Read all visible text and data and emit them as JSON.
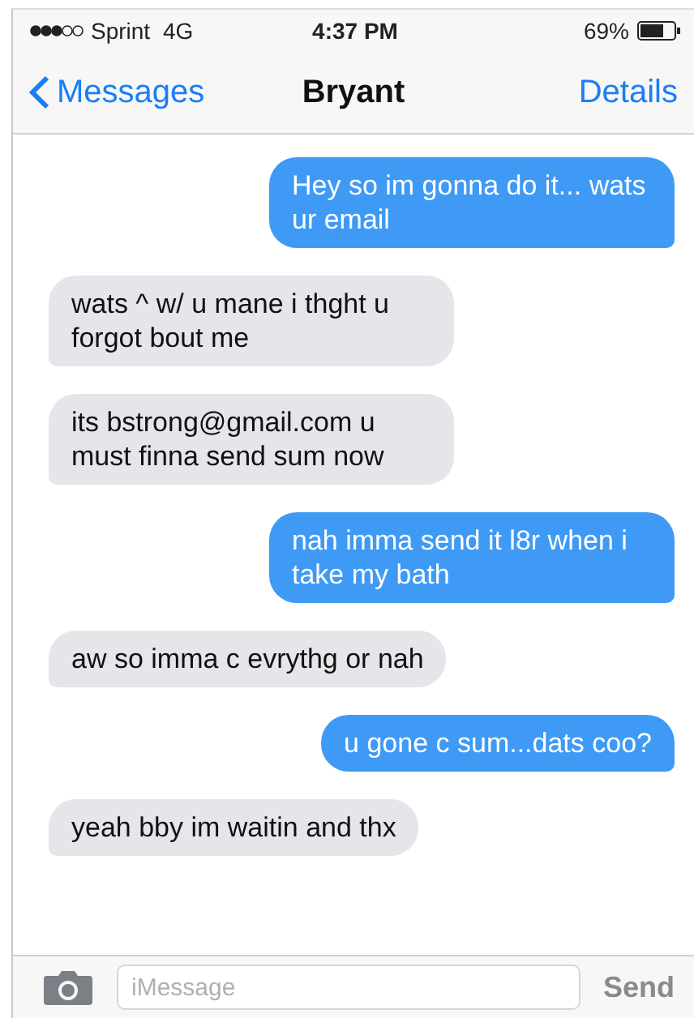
{
  "status_bar": {
    "carrier": "Sprint",
    "network": "4G",
    "time": "4:37 PM",
    "battery": "69%"
  },
  "nav": {
    "back": "Messages",
    "title": "Bryant",
    "action": "Details"
  },
  "messages": [
    {
      "kind": "sent",
      "text": "Hey so im gonna do it... wats ur email"
    },
    {
      "kind": "received",
      "text": "wats ^ w/ u mane i thght u forgot bout me"
    },
    {
      "kind": "received",
      "text": "its bstrong@gmail.com u must finna send sum now"
    },
    {
      "kind": "sent",
      "text": "nah imma send it l8r when i take my bath"
    },
    {
      "kind": "received",
      "text": "aw so imma c evrythg or nah"
    },
    {
      "kind": "sent",
      "text": "u gone c sum...dats coo?"
    },
    {
      "kind": "received",
      "text": "yeah bby im waitin and thx"
    }
  ],
  "composer": {
    "placeholder": "iMessage",
    "send": "Send"
  }
}
